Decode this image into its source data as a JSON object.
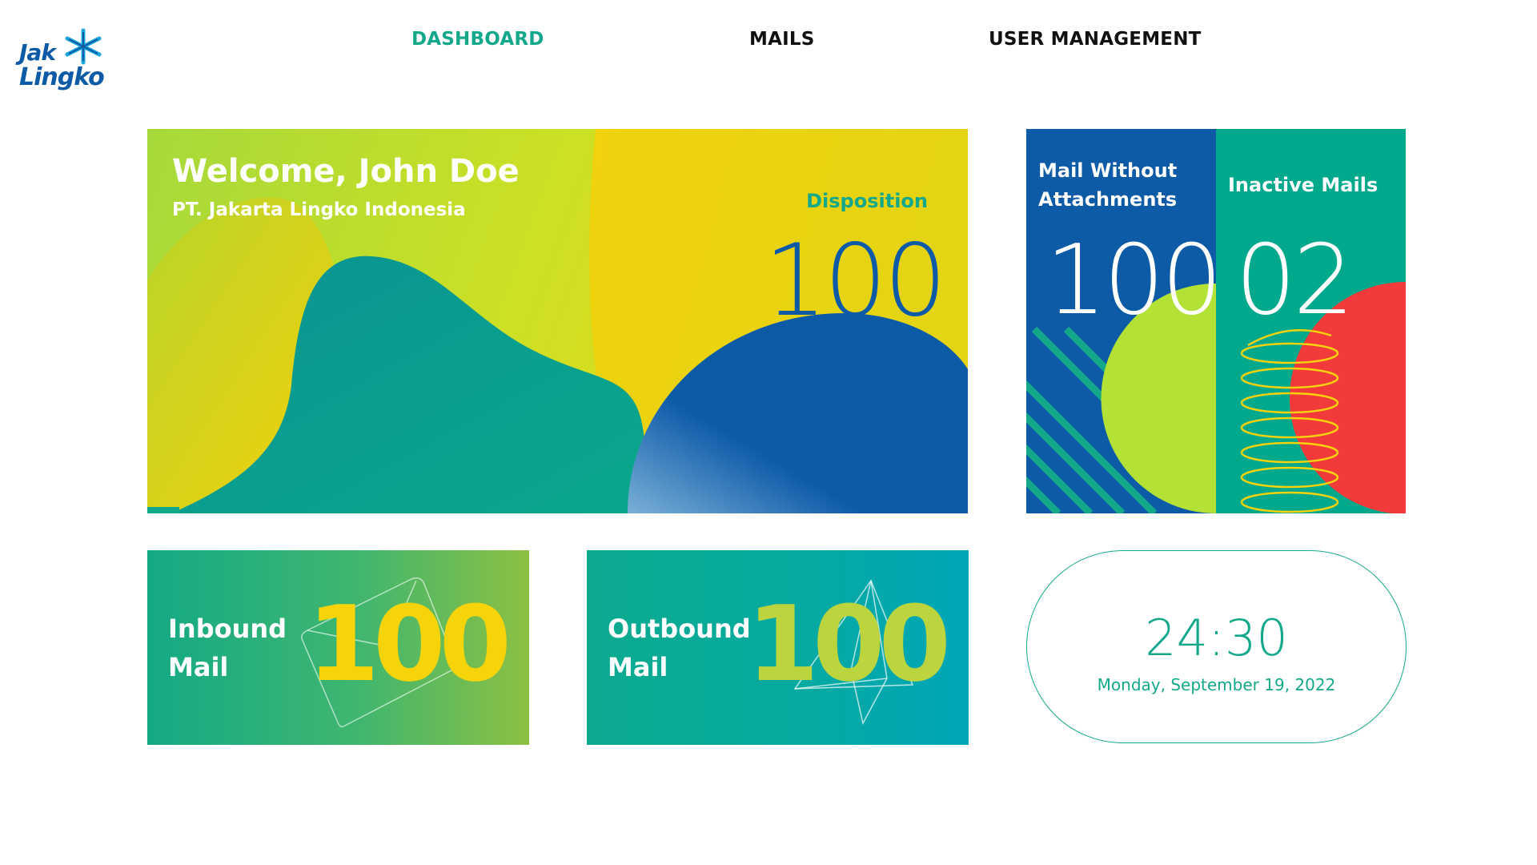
{
  "header": {
    "logo_text_line1": "Jak",
    "logo_text_line2": "Lingko",
    "nav": [
      {
        "label": "DASHBOARD",
        "active": true
      },
      {
        "label": "MAILS",
        "active": false
      },
      {
        "label": "USER MANAGEMENT",
        "active": false
      }
    ]
  },
  "welcome": {
    "title": "Welcome, John Doe",
    "company": "PT. Jakarta Lingko Indonesia",
    "disposition_label": "Disposition",
    "disposition_value": "100"
  },
  "stats": {
    "mail_without_attachments": {
      "label_line1": "Mail Without",
      "label_line2": "Attachments",
      "value": "100"
    },
    "inactive_mails": {
      "label": "Inactive Mails",
      "value": "02"
    }
  },
  "cards": {
    "inbound": {
      "label_line1": "Inbound",
      "label_line2": "Mail",
      "value": "100"
    },
    "outbound": {
      "label_line1": "Outbound",
      "label_line2": "Mail",
      "value": "100"
    }
  },
  "clock": {
    "time": "24:30",
    "date": "Monday, September 19, 2022"
  },
  "colors": {
    "brand_blue": "#0d5aa7",
    "brand_green": "#14a88a",
    "yellow": "#f5d20c",
    "lime": "#b3e135",
    "red": "#f23a3a"
  },
  "icons": [
    "logo-star-icon",
    "envelope-outline-icon",
    "paper-plane-outline-icon"
  ]
}
